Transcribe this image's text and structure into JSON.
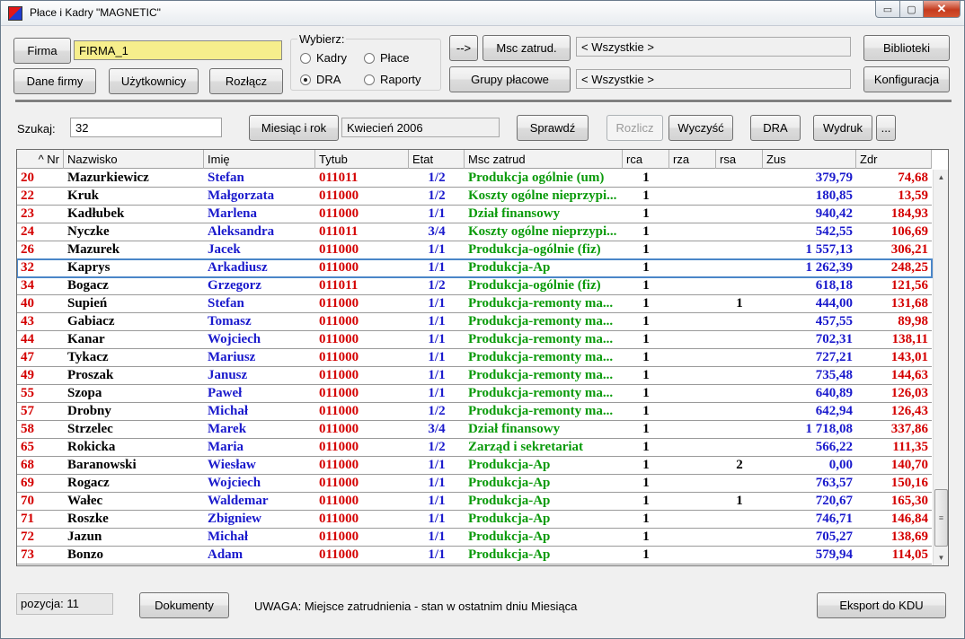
{
  "window": {
    "title": "Płace i Kadry \"MAGNETIC\"",
    "controls": {
      "minimize": "▭",
      "maximize": "▢",
      "close": "✕"
    }
  },
  "top": {
    "firma_button": "Firma",
    "firma_value": "FIRMA_1",
    "dane_firmy": "Dane firmy",
    "uzytkownicy": "Użytkownicy",
    "rozlacz": "Rozłącz",
    "wybierz_label": "Wybierz:",
    "radios": [
      {
        "label": "Kadry",
        "selected": false
      },
      {
        "label": "Płace",
        "selected": false
      },
      {
        "label": "DRA",
        "selected": true
      },
      {
        "label": "Raporty",
        "selected": false
      }
    ],
    "arrow_button": "-->",
    "msc_zatrud_button": "Msc zatrud.",
    "msc_zatrud_value": "< Wszystkie >",
    "grupy_placowe_button": "Grupy płacowe",
    "grupy_placowe_value": "< Wszystkie >",
    "biblioteki": "Biblioteki",
    "konfiguracja": "Konfiguracja"
  },
  "search": {
    "label": "Szukaj:",
    "value": "32",
    "miesiac_button": "Miesiąc i rok",
    "miesiac_value": "Kwiecień  2006",
    "sprawdz": "Sprawdź",
    "rozlicz": "Rozlicz",
    "wyczysc": "Wyczyść",
    "dra": "DRA",
    "wydruk": "Wydruk",
    "more": "..."
  },
  "grid": {
    "columns": [
      "^ Nr",
      "Nazwisko",
      "Imię",
      "Tytub",
      "Etat",
      "Msc zatrud",
      "rca",
      "rza",
      "rsa",
      "Zus",
      "Zdr"
    ],
    "selected_nr": "32",
    "rows": [
      {
        "nr": "20",
        "nazwisko": "Mazurkiewicz",
        "imie": "Stefan",
        "tytub": "011011",
        "etat": "1/2",
        "msc": "Produkcja ogólnie (um)",
        "rca": "1",
        "rza": "",
        "rsa": "",
        "zus": "379,79",
        "zdr": "74,68"
      },
      {
        "nr": "22",
        "nazwisko": "Kruk",
        "imie": "Małgorzata",
        "tytub": "011000",
        "etat": "1/2",
        "msc": "Koszty ogólne nieprzypi...",
        "rca": "1",
        "rza": "",
        "rsa": "",
        "zus": "180,85",
        "zdr": "13,59"
      },
      {
        "nr": "23",
        "nazwisko": "Kadłubek",
        "imie": "Marlena",
        "tytub": "011000",
        "etat": "1/1",
        "msc": "Dział finansowy",
        "rca": "1",
        "rza": "",
        "rsa": "",
        "zus": "940,42",
        "zdr": "184,93"
      },
      {
        "nr": "24",
        "nazwisko": "Nyczke",
        "imie": "Aleksandra",
        "tytub": "011011",
        "etat": "3/4",
        "msc": "Koszty ogólne nieprzypi...",
        "rca": "1",
        "rza": "",
        "rsa": "",
        "zus": "542,55",
        "zdr": "106,69"
      },
      {
        "nr": "26",
        "nazwisko": "Mazurek",
        "imie": "Jacek",
        "tytub": "011000",
        "etat": "1/1",
        "msc": "Produkcja-ogólnie (fiz)",
        "rca": "1",
        "rza": "",
        "rsa": "",
        "zus": "1 557,13",
        "zdr": "306,21"
      },
      {
        "nr": "32",
        "nazwisko": "Kaprys",
        "imie": "Arkadiusz",
        "tytub": "011000",
        "etat": "1/1",
        "msc": "Produkcja-Ap",
        "rca": "1",
        "rza": "",
        "rsa": "",
        "zus": "1 262,39",
        "zdr": "248,25"
      },
      {
        "nr": "34",
        "nazwisko": "Bogacz",
        "imie": "Grzegorz",
        "tytub": "011011",
        "etat": "1/2",
        "msc": "Produkcja-ogólnie (fiz)",
        "rca": "1",
        "rza": "",
        "rsa": "",
        "zus": "618,18",
        "zdr": "121,56"
      },
      {
        "nr": "40",
        "nazwisko": "Supień",
        "imie": "Stefan",
        "tytub": "011000",
        "etat": "1/1",
        "msc": "Produkcja-remonty ma...",
        "rca": "1",
        "rza": "",
        "rsa": "1",
        "zus": "444,00",
        "zdr": "131,68"
      },
      {
        "nr": "43",
        "nazwisko": "Gabiacz",
        "imie": "Tomasz",
        "tytub": "011000",
        "etat": "1/1",
        "msc": "Produkcja-remonty ma...",
        "rca": "1",
        "rza": "",
        "rsa": "",
        "zus": "457,55",
        "zdr": "89,98"
      },
      {
        "nr": "44",
        "nazwisko": "Kanar",
        "imie": "Wojciech",
        "tytub": "011000",
        "etat": "1/1",
        "msc": "Produkcja-remonty ma...",
        "rca": "1",
        "rza": "",
        "rsa": "",
        "zus": "702,31",
        "zdr": "138,11"
      },
      {
        "nr": "47",
        "nazwisko": "Tykacz",
        "imie": "Mariusz",
        "tytub": "011000",
        "etat": "1/1",
        "msc": "Produkcja-remonty ma...",
        "rca": "1",
        "rza": "",
        "rsa": "",
        "zus": "727,21",
        "zdr": "143,01"
      },
      {
        "nr": "49",
        "nazwisko": "Proszak",
        "imie": "Janusz",
        "tytub": "011000",
        "etat": "1/1",
        "msc": "Produkcja-remonty ma...",
        "rca": "1",
        "rza": "",
        "rsa": "",
        "zus": "735,48",
        "zdr": "144,63"
      },
      {
        "nr": "55",
        "nazwisko": "Szopa",
        "imie": "Paweł",
        "tytub": "011000",
        "etat": "1/1",
        "msc": "Produkcja-remonty ma...",
        "rca": "1",
        "rza": "",
        "rsa": "",
        "zus": "640,89",
        "zdr": "126,03"
      },
      {
        "nr": "57",
        "nazwisko": "Drobny",
        "imie": "Michał",
        "tytub": "011000",
        "etat": "1/2",
        "msc": "Produkcja-remonty ma...",
        "rca": "1",
        "rza": "",
        "rsa": "",
        "zus": "642,94",
        "zdr": "126,43"
      },
      {
        "nr": "58",
        "nazwisko": "Strzelec",
        "imie": "Marek",
        "tytub": "011000",
        "etat": "3/4",
        "msc": "Dział finansowy",
        "rca": "1",
        "rza": "",
        "rsa": "",
        "zus": "1 718,08",
        "zdr": "337,86"
      },
      {
        "nr": "65",
        "nazwisko": "Rokicka",
        "imie": "Maria",
        "tytub": "011000",
        "etat": "1/2",
        "msc": "Zarząd i sekretariat",
        "rca": "1",
        "rza": "",
        "rsa": "",
        "zus": "566,22",
        "zdr": "111,35"
      },
      {
        "nr": "68",
        "nazwisko": "Baranowski",
        "imie": "Wiesław",
        "tytub": "011000",
        "etat": "1/1",
        "msc": "Produkcja-Ap",
        "rca": "1",
        "rza": "",
        "rsa": "2",
        "zus": "0,00",
        "zdr": "140,70"
      },
      {
        "nr": "69",
        "nazwisko": "Rogacz",
        "imie": "Wojciech",
        "tytub": "011000",
        "etat": "1/1",
        "msc": "Produkcja-Ap",
        "rca": "1",
        "rza": "",
        "rsa": "",
        "zus": "763,57",
        "zdr": "150,16"
      },
      {
        "nr": "70",
        "nazwisko": "Wałec",
        "imie": "Waldemar",
        "tytub": "011000",
        "etat": "1/1",
        "msc": "Produkcja-Ap",
        "rca": "1",
        "rza": "",
        "rsa": "1",
        "zus": "720,67",
        "zdr": "165,30"
      },
      {
        "nr": "71",
        "nazwisko": "Roszke",
        "imie": "Zbigniew",
        "tytub": "011000",
        "etat": "1/1",
        "msc": "Produkcja-Ap",
        "rca": "1",
        "rza": "",
        "rsa": "",
        "zus": "746,71",
        "zdr": "146,84"
      },
      {
        "nr": "72",
        "nazwisko": "Jazun",
        "imie": "Michał",
        "tytub": "011000",
        "etat": "1/1",
        "msc": "Produkcja-Ap",
        "rca": "1",
        "rza": "",
        "rsa": "",
        "zus": "705,27",
        "zdr": "138,69"
      },
      {
        "nr": "73",
        "nazwisko": "Bonzo",
        "imie": "Adam",
        "tytub": "011000",
        "etat": "1/1",
        "msc": "Produkcja-Ap",
        "rca": "1",
        "rza": "",
        "rsa": "",
        "zus": "579,94",
        "zdr": "114,05"
      }
    ]
  },
  "footer": {
    "pozycja_label": "pozycja:",
    "pozycja_value": "11",
    "dokumenty": "Dokumenty",
    "uwaga": "UWAGA:  Miejsce zatrudnienia - stan w ostatnim dniu Miesiąca",
    "eksport": "Eksport do KDU"
  },
  "colors": {
    "nr": "#d40000",
    "imie": "#1a1acc",
    "msc": "#0a9a0a",
    "firma_field": "#f6ee8c",
    "selection": "#4a86c8"
  },
  "icons": {
    "app": "app-icon",
    "minimize": "minimize-icon",
    "maximize": "maximize-icon",
    "close": "close-icon",
    "scroll_up": "chevron-up-icon",
    "scroll_down": "chevron-down-icon"
  }
}
